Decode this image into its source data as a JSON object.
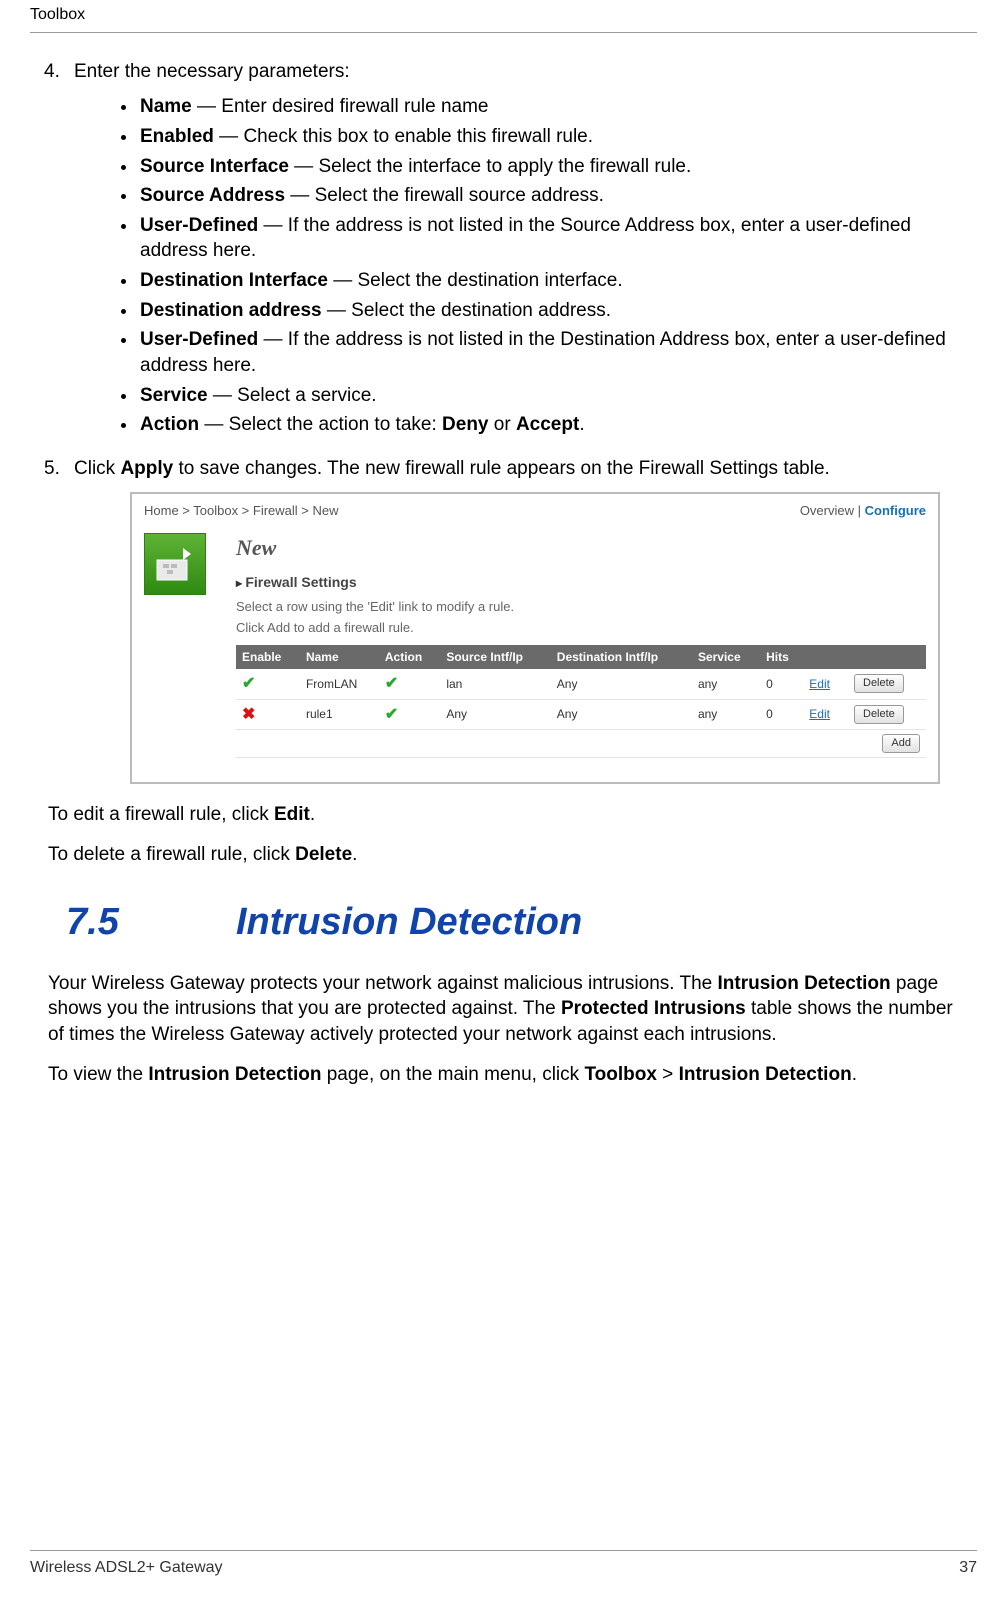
{
  "header": {
    "title": "Toolbox"
  },
  "step4": {
    "number": "4.",
    "intro": "Enter the necessary parameters:",
    "items": [
      {
        "term": "Name",
        "desc": " — Enter desired firewall rule name"
      },
      {
        "term": "Enabled",
        "desc": " — Check this box to enable this firewall rule."
      },
      {
        "term": "Source Interface",
        "desc": " — Select the interface to apply the firewall rule."
      },
      {
        "term": "Source Address",
        "desc": " — Select the firewall source address."
      },
      {
        "term": "User-Defined",
        "desc": " — If the address is not listed in the Source Address box, enter a user-defined address here."
      },
      {
        "term": "Destination Interface",
        "desc": " — Select the destination interface."
      },
      {
        "term": "Destination address",
        "desc": " — Select the destination address."
      },
      {
        "term": "User-Defined",
        "desc": " — If the address is not listed in the Destination Address box, enter a user-defined address here."
      },
      {
        "term": "Service",
        "desc": " — Select a service."
      }
    ],
    "action_item": {
      "term": "Action",
      "mid": " — Select the action to take: ",
      "opt1": "Deny",
      "or": " or ",
      "opt2": "Accept",
      "end": "."
    }
  },
  "step5": {
    "number": "5.",
    "pre": "Click ",
    "apply": "Apply",
    "post": " to save changes. The new firewall rule appears on the Firewall Settings table."
  },
  "screenshot": {
    "breadcrumb": "Home > Toolbox > Firewall > New",
    "overview": "Overview",
    "sep": " | ",
    "configure": "Configure",
    "title": "New",
    "subtitle": "Firewall Settings",
    "line1": "Select a row using the 'Edit' link to modify a rule.",
    "line2": "Click Add to add a firewall rule.",
    "cols": {
      "enable": "Enable",
      "name": "Name",
      "action": "Action",
      "src": "Source Intf/Ip",
      "dst": "Destination Intf/Ip",
      "service": "Service",
      "hits": "Hits"
    },
    "rows": [
      {
        "enable": "✔",
        "enable_class": "chk-y",
        "name": "FromLAN",
        "action": "✔",
        "src": "lan",
        "dst": "Any",
        "service": "any",
        "hits": "0"
      },
      {
        "enable": "✖",
        "enable_class": "chk-n",
        "name": "rule1",
        "action": "✔",
        "src": "Any",
        "dst": "Any",
        "service": "any",
        "hits": "0"
      }
    ],
    "edit": "Edit",
    "delete_btn": "Delete",
    "add_btn": "Add"
  },
  "post": {
    "edit_pre": "To edit a firewall rule, click ",
    "edit_word": "Edit",
    "edit_post": ".",
    "del_pre": "To delete a firewall rule, click ",
    "del_word": "Delete",
    "del_post": "."
  },
  "section": {
    "num": "7.5",
    "title": "Intrusion Detection"
  },
  "intro_para": {
    "t1": "Your Wireless Gateway protects your network against malicious intrusions. The ",
    "b1": "Intrusion Detection",
    "t2": " page shows you the intrusions that you are protected against. The ",
    "b2": "Protected Intrusions",
    "t3": " table shows the number of times the Wireless Gateway actively protected your network against each intrusions."
  },
  "view_para": {
    "t1": "To view the ",
    "b1": "Intrusion Detection",
    "t2": " page, on the main menu, click ",
    "b2": "Toolbox",
    "t3": " > ",
    "b3": "Intrusion Detection",
    "t4": "."
  },
  "footer": {
    "left": "Wireless ADSL2+ Gateway",
    "right": "37"
  }
}
